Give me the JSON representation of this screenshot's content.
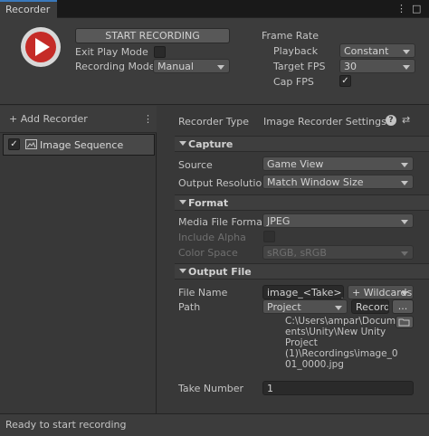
{
  "window": {
    "tab_title": "Recorder",
    "menu_glyph": "⋮",
    "max_glyph": "□"
  },
  "toolbar": {
    "start_label": "START RECORDING",
    "exit_play_mode_label": "Exit Play Mode",
    "exit_play_mode_checked": false,
    "recording_mode_label": "Recording Mode",
    "recording_mode_value": "Manual",
    "frame_rate_heading": "Frame Rate",
    "playback_label": "Playback",
    "playback_value": "Constant",
    "target_fps_label": "Target FPS",
    "target_fps_value": "30",
    "cap_fps_label": "Cap FPS",
    "cap_fps_checked": true,
    "check_glyph": "✓"
  },
  "recorder_list": {
    "add_label": "+ Add Recorder",
    "menu_glyph": "⋮",
    "items": [
      {
        "label": "Image Sequence",
        "enabled": true,
        "check_glyph": "✓"
      }
    ]
  },
  "settings": {
    "recorder_type_label": "Recorder Type",
    "recorder_type_value": "Image Recorder Settings",
    "help_glyph": "?",
    "preset_glyph": "⇄",
    "capture": {
      "heading": "Capture",
      "source_label": "Source",
      "source_value": "Game View",
      "output_resolution_label": "Output Resolution",
      "output_resolution_value": "Match Window Size"
    },
    "format": {
      "heading": "Format",
      "media_format_label": "Media File Format",
      "media_format_value": "JPEG",
      "include_alpha_label": "Include Alpha",
      "color_space_label": "Color Space",
      "color_space_value": "sRGB, sRGB"
    },
    "output": {
      "heading": "Output File",
      "file_name_label": "File Name",
      "file_name_value": "image_<Take>_<",
      "wildcards_label": "+ Wildcards",
      "path_label": "Path",
      "path_value": "Project",
      "record_label": "Record",
      "browse_label": "...",
      "path_lines": [
        "C:\\Users\\ampar\\Docum",
        "ents\\Unity\\New Unity",
        "Project",
        "(1)\\Recordings\\image_0",
        "01_0000.jpg"
      ],
      "take_number_label": "Take Number",
      "take_number_value": "1"
    }
  },
  "status": {
    "text": "Ready to start recording"
  },
  "colors": {
    "record_red": "#c52b27",
    "tab_accent": "#3a79bb"
  }
}
